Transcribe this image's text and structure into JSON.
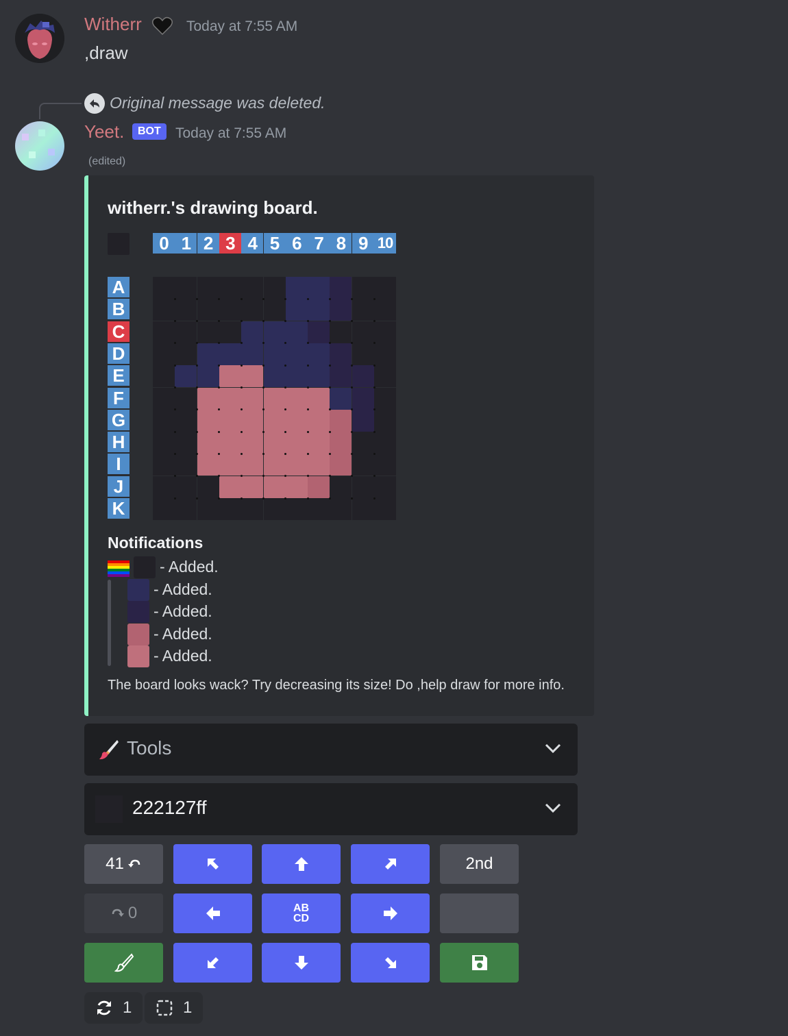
{
  "message1": {
    "username": "Witherr",
    "timestamp": "Today at 7:55 AM",
    "text": ",draw"
  },
  "reply": {
    "text": "Original message was deleted."
  },
  "message2": {
    "username": "Yeet.",
    "badge": "BOT",
    "timestamp": "Today at 7:55 AM",
    "edited": "(edited)"
  },
  "embed": {
    "accent_color": "#8ef1c4",
    "title": "witherr.'s drawing board.",
    "columns": [
      "0",
      "1",
      "2",
      "3",
      "4",
      "5",
      "6",
      "7",
      "8",
      "9",
      "10"
    ],
    "rows": [
      "A",
      "B",
      "C",
      "D",
      "E",
      "F",
      "G",
      "H",
      "I",
      "J",
      "K"
    ],
    "cursor": {
      "column": "3",
      "row": "C"
    },
    "palette": {
      "0": "#222127",
      "1": "#2d2d5a",
      "2": "#2a2347",
      "3": "#b26371",
      "4": "#bf707c"
    },
    "grid": [
      "00000011200",
      "00000011200",
      "00001112000",
      "00111111200",
      "01144111220",
      "00444444120",
      "00444444320",
      "00444444300",
      "00444444300",
      "00044443000",
      "00000000000"
    ],
    "notifications_title": "Notifications",
    "notifications": [
      {
        "color": "#222127",
        "text": "- Added."
      },
      {
        "color": "#2d2d5a",
        "text": "- Added."
      },
      {
        "color": "#2a2347",
        "text": "- Added."
      },
      {
        "color": "#b26371",
        "text": "- Added."
      },
      {
        "color": "#bf707c",
        "text": "- Added."
      }
    ],
    "footer": "The board looks wack? Try decreasing its size! Do ,help draw for more info."
  },
  "tools_select": {
    "label": "Tools",
    "icon": "paintbrush-icon"
  },
  "color_select": {
    "value": "222127ff",
    "swatch": "#222127"
  },
  "buttons": {
    "undo": "41",
    "redo": "0",
    "second": "2nd",
    "abcd_top": "AB",
    "abcd_bottom": "CD"
  },
  "reactions": [
    {
      "icon": "refresh-icon",
      "count": "1"
    },
    {
      "icon": "selection-icon",
      "count": "1"
    }
  ]
}
